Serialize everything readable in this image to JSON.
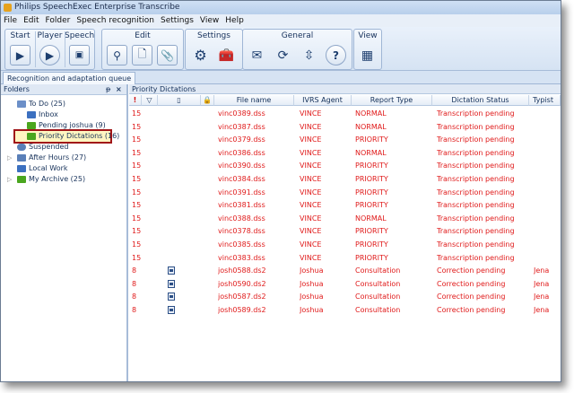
{
  "window": {
    "title": "Philips SpeechExec Enterprise Transcribe"
  },
  "menu": [
    "File",
    "Edit",
    "Folder",
    "Speech recognition",
    "Settings",
    "View",
    "Help"
  ],
  "toolbar": {
    "groups": [
      {
        "label": "Start",
        "buttons": [
          "play-triangle-icon"
        ]
      },
      {
        "label": "Player",
        "buttons": [
          "player-icon"
        ]
      },
      {
        "label": "Speech",
        "buttons": [
          "speech-icon"
        ]
      },
      {
        "label": "Edit",
        "buttons": [
          "magnifier-icon",
          "document-add-icon",
          "attachment-icon"
        ]
      },
      {
        "label": "Settings",
        "buttons": [
          "gear-icon",
          "tools-icon"
        ]
      },
      {
        "label": "General",
        "buttons": [
          "envelope-icon",
          "refresh-icon",
          "up-down-arrows-icon",
          "help-icon"
        ]
      },
      {
        "label": "View",
        "buttons": [
          "view-icon"
        ]
      }
    ]
  },
  "tabs": [
    "Recognition and adaptation queue"
  ],
  "folders": {
    "title": "Folders",
    "items": [
      {
        "label": "To Do (25)",
        "icon": "tray-icon",
        "color": "#6c8fc8"
      },
      {
        "label": "Inbox",
        "icon": "inbox-icon",
        "color": "#3c70c0"
      },
      {
        "label": "Pending joshua (9)",
        "icon": "folder-green-icon",
        "color": "#4aa61f"
      },
      {
        "label": "Priority Dictations (16)",
        "icon": "folder-green-icon",
        "color": "#4aa61f"
      },
      {
        "label": "Suspended",
        "icon": "clock-icon",
        "color": "#5a7fb8"
      },
      {
        "label": "After Hours (27)",
        "icon": "folder-icon",
        "color": "#5a7fb8"
      },
      {
        "label": "Local Work",
        "icon": "house-icon",
        "color": "#3c70c0"
      },
      {
        "label": "My Archive (25)",
        "icon": "archive-icon",
        "color": "#4aa61f"
      }
    ],
    "pin_glyph": "ᵽ",
    "close_glyph": "×"
  },
  "grid": {
    "title": "Priority Dictations",
    "columns": [
      "!",
      "▽",
      "▯",
      "🔒",
      "File name",
      "IVRS Agent",
      "Report Type",
      "Dictation Status",
      "Typist"
    ],
    "rows": [
      {
        "priority": "15",
        "attach": false,
        "file": "vinc0389.dss",
        "agent": "VINCE",
        "report": "NORMAL",
        "status": "Transcription pending",
        "typist": ""
      },
      {
        "priority": "15",
        "attach": false,
        "file": "vinc0387.dss",
        "agent": "VINCE",
        "report": "NORMAL",
        "status": "Transcription pending",
        "typist": ""
      },
      {
        "priority": "15",
        "attach": false,
        "file": "vinc0379.dss",
        "agent": "VINCE",
        "report": "PRIORITY",
        "status": "Transcription pending",
        "typist": ""
      },
      {
        "priority": "15",
        "attach": false,
        "file": "vinc0386.dss",
        "agent": "VINCE",
        "report": "NORMAL",
        "status": "Transcription pending",
        "typist": ""
      },
      {
        "priority": "15",
        "attach": false,
        "file": "vinc0390.dss",
        "agent": "VINCE",
        "report": "PRIORITY",
        "status": "Transcription pending",
        "typist": ""
      },
      {
        "priority": "15",
        "attach": false,
        "file": "vinc0384.dss",
        "agent": "VINCE",
        "report": "PRIORITY",
        "status": "Transcription pending",
        "typist": ""
      },
      {
        "priority": "15",
        "attach": false,
        "file": "vinc0391.dss",
        "agent": "VINCE",
        "report": "PRIORITY",
        "status": "Transcription pending",
        "typist": ""
      },
      {
        "priority": "15",
        "attach": false,
        "file": "vinc0381.dss",
        "agent": "VINCE",
        "report": "PRIORITY",
        "status": "Transcription pending",
        "typist": ""
      },
      {
        "priority": "15",
        "attach": false,
        "file": "vinc0388.dss",
        "agent": "VINCE",
        "report": "NORMAL",
        "status": "Transcription pending",
        "typist": ""
      },
      {
        "priority": "15",
        "attach": false,
        "file": "vinc0378.dss",
        "agent": "VINCE",
        "report": "PRIORITY",
        "status": "Transcription pending",
        "typist": ""
      },
      {
        "priority": "15",
        "attach": false,
        "file": "vinc0385.dss",
        "agent": "VINCE",
        "report": "PRIORITY",
        "status": "Transcription pending",
        "typist": ""
      },
      {
        "priority": "15",
        "attach": false,
        "file": "vinc0383.dss",
        "agent": "VINCE",
        "report": "PRIORITY",
        "status": "Transcription pending",
        "typist": ""
      },
      {
        "priority": "8",
        "attach": true,
        "file": "josh0588.ds2",
        "agent": "Joshua",
        "report": "Consultation",
        "status": "Correction pending",
        "typist": "Jena"
      },
      {
        "priority": "8",
        "attach": true,
        "file": "josh0590.ds2",
        "agent": "Joshua",
        "report": "Consultation",
        "status": "Correction pending",
        "typist": "Jena"
      },
      {
        "priority": "8",
        "attach": true,
        "file": "josh0587.ds2",
        "agent": "Joshua",
        "report": "Consultation",
        "status": "Correction pending",
        "typist": "Jena"
      },
      {
        "priority": "8",
        "attach": true,
        "file": "josh0589.ds2",
        "agent": "Joshua",
        "report": "Consultation",
        "status": "Correction pending",
        "typist": "Jena"
      }
    ]
  },
  "colors": {
    "row_text": "#e01a1a",
    "highlight_border": "#a01518"
  }
}
